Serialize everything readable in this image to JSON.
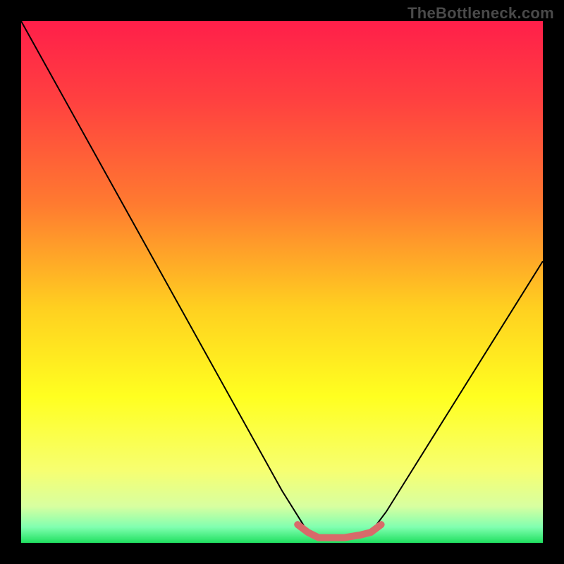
{
  "attribution": "TheBottleneck.com",
  "chart_data": {
    "type": "line",
    "title": "",
    "xlabel": "",
    "ylabel": "",
    "xlim": [
      0,
      100
    ],
    "ylim": [
      0,
      100
    ],
    "series": [
      {
        "name": "curve",
        "color": "#000000",
        "x": [
          0,
          10,
          20,
          30,
          40,
          50,
          55,
          57,
          62,
          67,
          70,
          80,
          90,
          100
        ],
        "y": [
          100,
          82,
          64,
          46,
          28,
          10,
          2,
          1,
          1,
          2,
          6,
          22,
          38,
          54
        ]
      },
      {
        "name": "minimum-plateau",
        "color": "#d86a6a",
        "x": [
          53,
          55,
          57,
          60,
          62,
          65,
          67,
          69
        ],
        "y": [
          3.5,
          2,
          1,
          1,
          1,
          1.5,
          2,
          3.5
        ]
      }
    ],
    "gradient_stops": [
      {
        "offset": 0.0,
        "color": "#ff1f4a"
      },
      {
        "offset": 0.15,
        "color": "#ff4040"
      },
      {
        "offset": 0.35,
        "color": "#ff7a30"
      },
      {
        "offset": 0.55,
        "color": "#ffd020"
      },
      {
        "offset": 0.72,
        "color": "#ffff20"
      },
      {
        "offset": 0.86,
        "color": "#f7ff70"
      },
      {
        "offset": 0.93,
        "color": "#d8ffa0"
      },
      {
        "offset": 0.97,
        "color": "#80ffb0"
      },
      {
        "offset": 1.0,
        "color": "#20e060"
      }
    ]
  }
}
